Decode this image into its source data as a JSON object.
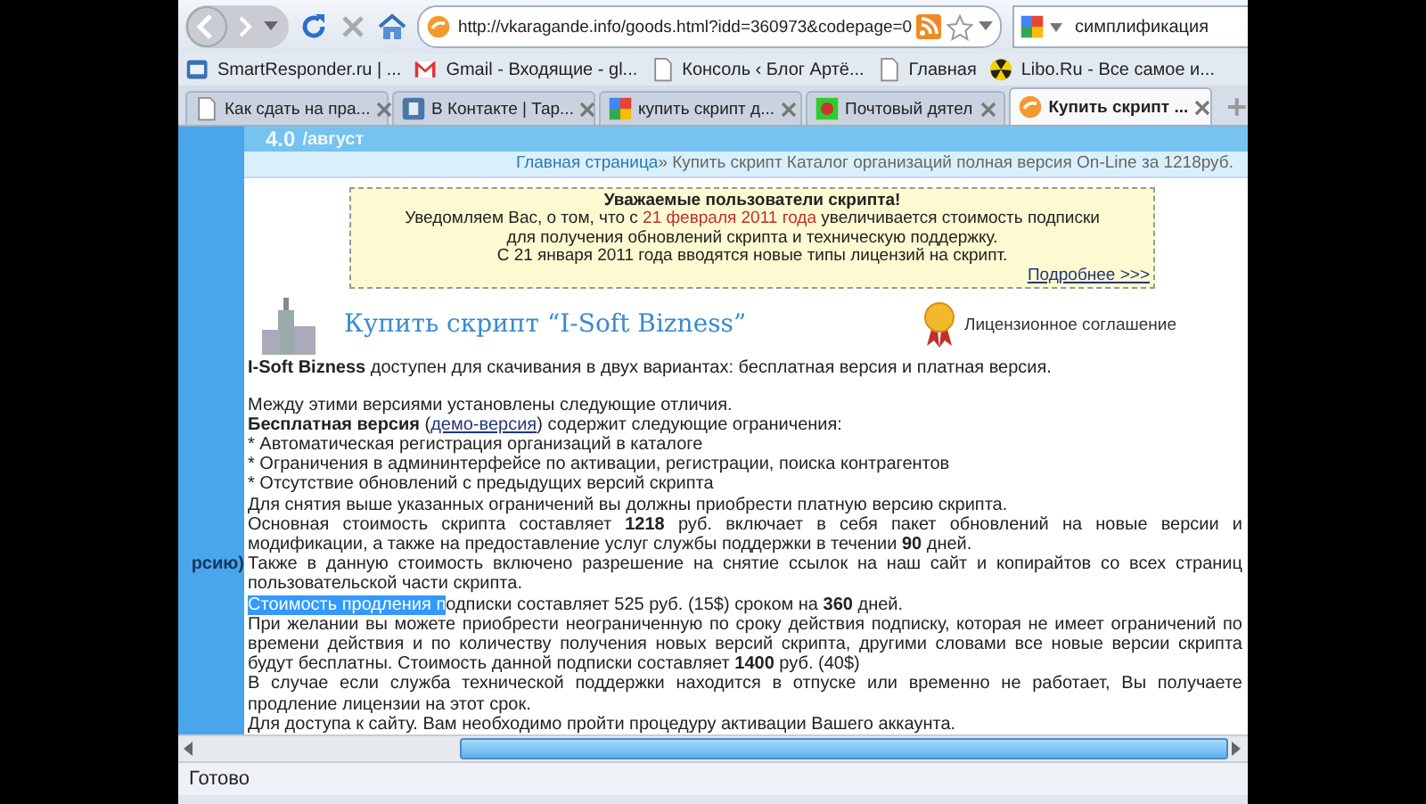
{
  "toolbar": {
    "url": "http://vkaragande.info/goods.html?idd=360973&codepage=0",
    "search_value": "симплификация"
  },
  "bookmarks": [
    {
      "label": "SmartResponder.ru | ..."
    },
    {
      "label": "Gmail - Входящие - gl..."
    },
    {
      "label": "Консоль ‹ Блог Артё..."
    },
    {
      "label": "Главная"
    },
    {
      "label": "Libo.Ru - Все самое и..."
    }
  ],
  "tabs": [
    {
      "label": "Как сдать на пра...",
      "selected": false
    },
    {
      "label": "В Контакте | Тар...",
      "selected": false
    },
    {
      "label": "купить скрипт д...",
      "selected": false
    },
    {
      "label": "Почтовый дятел",
      "selected": false
    },
    {
      "label": "Купить скрипт ...",
      "selected": true
    }
  ],
  "page": {
    "side_text": "рсию)",
    "header_version": "4.0",
    "header_month": "/август",
    "breadcrumb": {
      "home": "Главная страница",
      "rest": " » Купить скрипт Каталог организаций полная версия On-Line за 1218руб."
    },
    "notice": {
      "title": "Уважаемые пользователи скрипта!",
      "lines": [
        {
          "before": "Уведомляем Вас, о том, что с ",
          "date": "21 февраля 2011 года",
          "after": " увеличивается стоимость подписки"
        },
        {
          "before": "для получения обновлений скрипта и техническую поддержку."
        },
        {
          "before": "С 21 января 2011 года вводятся новые типы лицензий на скрипт."
        }
      ],
      "more_link": "Подробнее >>>"
    },
    "title": "Купить скрипт “I-Soft Bizness”",
    "license_link": "Лицензионное соглашение",
    "paragraphs": [
      {
        "kind": "text",
        "text": "**I-Soft Bizness** доступен для скачивания в двух вариантах: бесплатная версия и платная версия."
      },
      {
        "kind": "text",
        "text": "Между этими версиями установлены следующие отличия."
      },
      {
        "kind": "link",
        "before": "**Бесплатная версия** (",
        "link": "демо-версия",
        "after": ") содержит следующие ограничения:"
      },
      {
        "kind": "text",
        "text": "* Автоматическая регистрация организаций в каталоге"
      },
      {
        "kind": "text",
        "text": "* Ограничения в админинтерфейсе по активации, регистрации, поиска контрагентов"
      },
      {
        "kind": "text",
        "text": "* Отсутствие обновлений с предыдущих версий скрипта"
      },
      {
        "kind": "text",
        "text": "Для снятия выше указанных ограничений вы должны приобрести платную версию скрипта."
      },
      {
        "kind": "text",
        "text": "Основная стоимость скрипта составляет **1218** руб. включает в себя пакет обновлений на новые версии и модификации, а также на предоставление услуг службы поддержки в течении **90** дней."
      },
      {
        "kind": "text",
        "text": "Также в данную стоимость включено разрешение на снятие ссылок на наш сайт и копирайтов со всех страниц пользовательской части скрипта."
      },
      {
        "kind": "selection",
        "selected_part": "Стоимость продления п",
        "text": "одписки составляет 525 руб. (15$) сроком на **360** дней."
      },
      {
        "kind": "text",
        "text": "При желании вы можете приобрести неограниченную по сроку действия подписку, которая не имеет ограничений по времени действия и по количеству получения новых версий скрипта, другими словами все новые версии скрипта будут бесплатны. Стоимость данной подписки составляет **1400** руб. (40$)"
      },
      {
        "kind": "text",
        "text": "В случае если служба технической поддержки находится в отпуске или временно не работает, Вы получаете продление лицензии на этот срок."
      },
      {
        "kind": "text",
        "text": "Для доступа к сайту. Вам необходимо пройти процедуру активации Вашего аккаунта."
      }
    ]
  },
  "status_bar": {
    "text": "Готово"
  }
}
